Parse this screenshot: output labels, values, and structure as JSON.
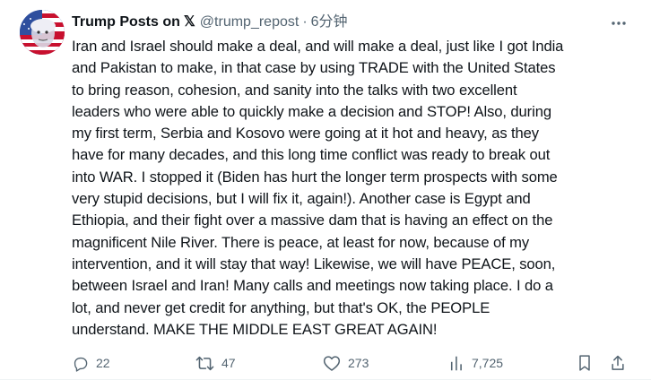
{
  "author": {
    "display_name": "Trump Posts on",
    "platform_logo": "𝕏",
    "handle": "@trump_repost",
    "separator": "·",
    "time": "6分钟",
    "avatar_icon": "avatar-flag-portrait"
  },
  "tweet": {
    "text": "Iran and Israel should make a deal, and will make a deal, just like I got India\nand Pakistan to make, in that case by using TRADE with the United States\nto bring reason, cohesion, and sanity into the talks with two excellent\nleaders who were able to quickly make a decision and STOP! Also, during\nmy first term, Serbia and Kosovo were going at it hot and heavy, as they\nhave for many decades, and this long time conflict was ready to break out\ninto WAR. I stopped it (Biden has hurt the longer term prospects with some\nvery stupid decisions, but I will fix it, again!). Another case is Egypt and\nEthiopia, and their fight over a massive dam that is having an effect on the\nmagnificent Nile River. There is peace, at least for now, because of my\nintervention, and it will stay that way! Likewise, we will have PEACE, soon,\nbetween Israel and Iran! Many calls and meetings now taking place. I do a\nlot, and never get credit for anything, but that's OK, the PEOPLE\nunderstand. MAKE THE MIDDLE EAST GREAT AGAIN!"
  },
  "actions": {
    "replies": "22",
    "reposts": "47",
    "likes": "273",
    "views": "7,725"
  },
  "colors": {
    "text": "#0f1419",
    "muted": "#536471",
    "background": "#ffffff"
  }
}
